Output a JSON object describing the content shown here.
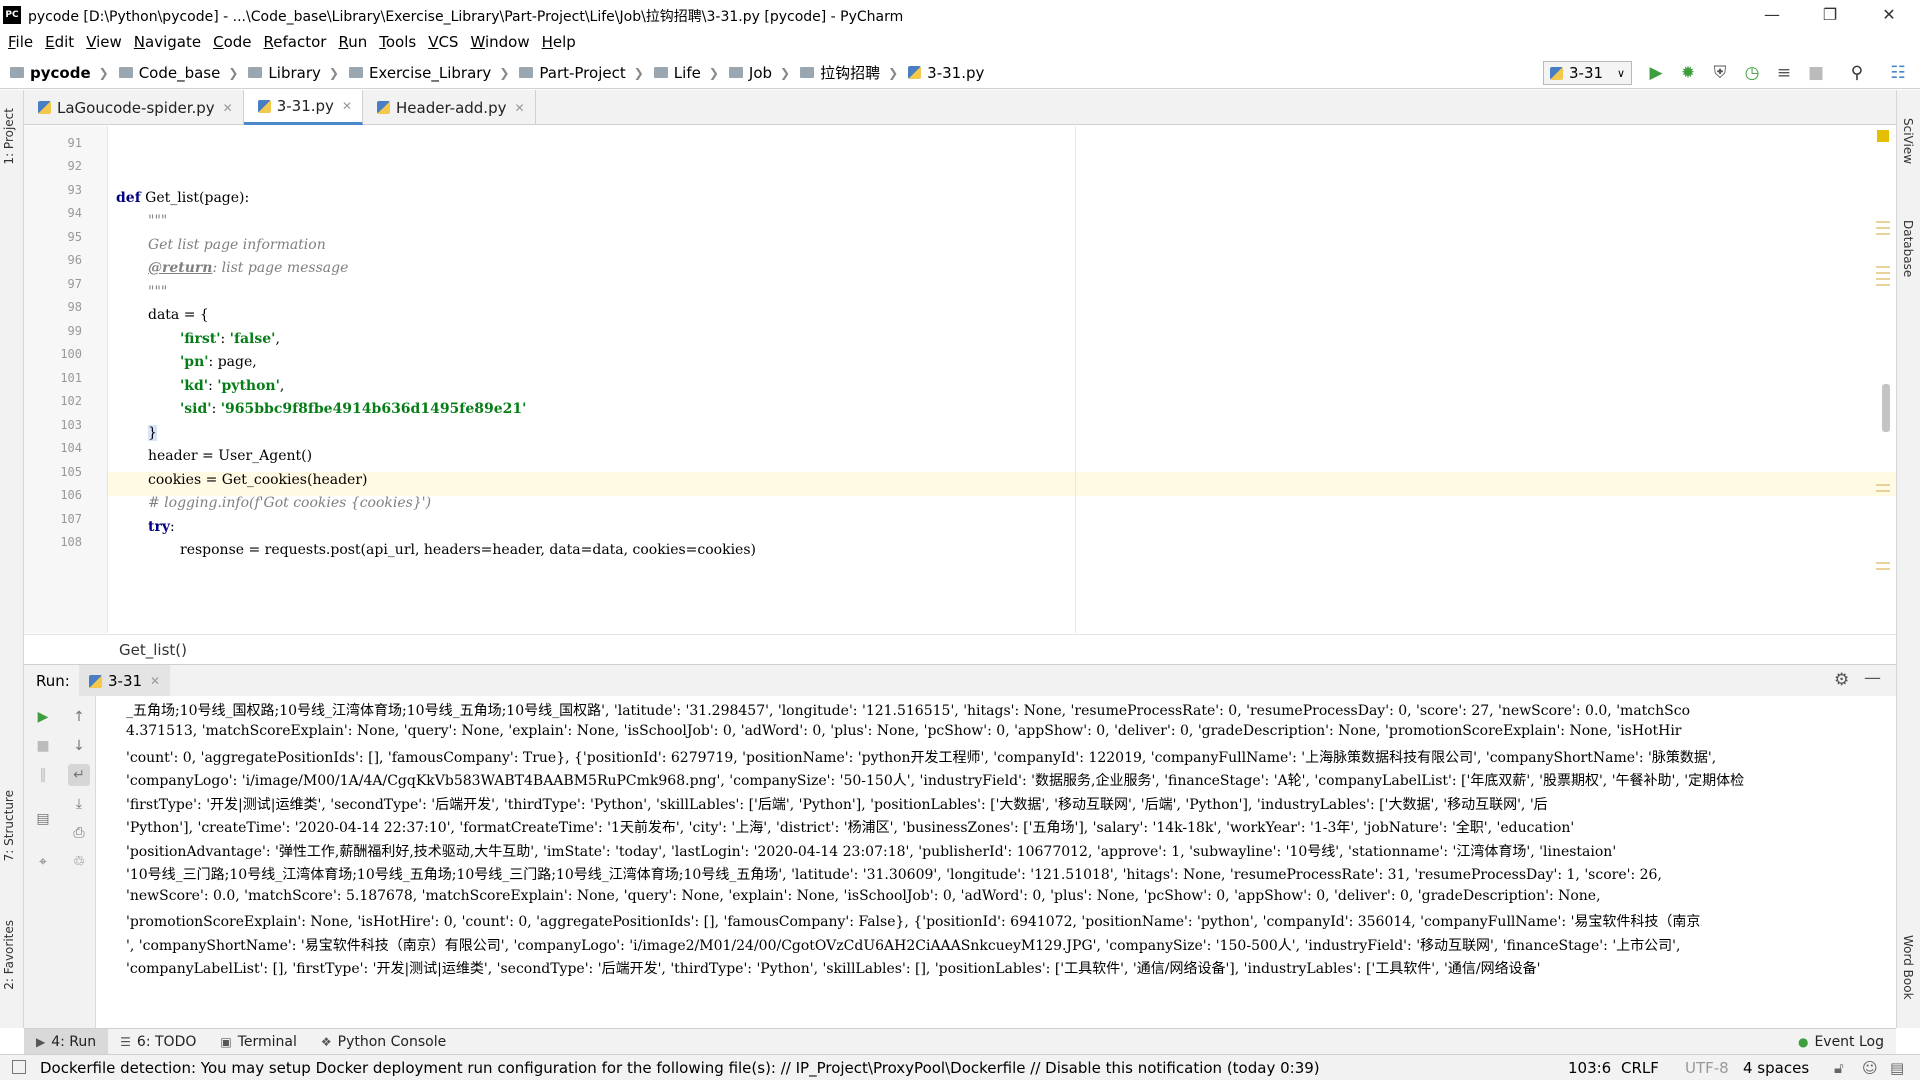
{
  "window": {
    "title": "pycode [D:\\Python\\pycode] - ...\\Code_base\\Library\\Exercise_Library\\Part-Project\\Life\\Job\\拉钩招聘\\3-31.py [pycode] - PyCharm",
    "logo": "PC"
  },
  "menu": [
    "File",
    "Edit",
    "View",
    "Navigate",
    "Code",
    "Refactor",
    "Run",
    "Tools",
    "VCS",
    "Window",
    "Help"
  ],
  "breadcrumbs": [
    "pycode",
    "Code_base",
    "Library",
    "Exercise_Library",
    "Part-Project",
    "Life",
    "Job",
    "拉钩招聘",
    "3-31.py"
  ],
  "run_config": "3-31",
  "left_tabs": {
    "project": "1: Project",
    "structure": "7: Structure",
    "favorites": "2: Favorites"
  },
  "right_tabs": {
    "sciview": "SciView",
    "database": "Database",
    "wordbook": "Word Book"
  },
  "editor_tabs": [
    {
      "label": "LaGoucode-spider.py",
      "active": false
    },
    {
      "label": "3-31.py",
      "active": true
    },
    {
      "label": "Header-add.py",
      "active": false
    }
  ],
  "line_numbers": [
    "91",
    "92",
    "93",
    "94",
    "95",
    "96",
    "97",
    "98",
    "99",
    "100",
    "101",
    "102",
    "103",
    "104",
    "105",
    "106",
    "107",
    "108"
  ],
  "code": {
    "l93_kw": "def",
    "l93_rest": " Get_list(page):",
    "l94": "\"\"\"",
    "l95": "Get list page information",
    "l96_tag": "@return",
    "l96_rest": ": list page message",
    "l97": "\"\"\"",
    "l98": "data = {",
    "l99_key": "'first'",
    "l99_rest": ": ",
    "l99_val": "'false'",
    "l99_end": ",",
    "l100_key": "'pn'",
    "l100_rest": ": page,",
    "l101_key": "'kd'",
    "l101_rest": ": ",
    "l101_val": "'python'",
    "l101_end": ",",
    "l102_key": "'sid'",
    "l102_rest": ": ",
    "l102_val": "'965bbc9f8fbe4914b636d1495fe89e21'",
    "l103": "}",
    "l104": "header = User_Agent()",
    "l105": "cookies = Get_cookies(header)",
    "l106": "# logging.info(f'Got cookies {cookies}')",
    "l107_kw": "try",
    "l107_rest": ":",
    "l108": "response = requests.post(api_url, headers=header, data=data, cookies=cookies)"
  },
  "editor_breadcrumb": "Get_list()",
  "run": {
    "label": "Run:",
    "tab": "3-31",
    "console_lines": [
      "_五角场;10号线_国权路;10号线_江湾体育场;10号线_五角场;10号线_国权路', 'latitude': '31.298457', 'longitude': '121.516515', 'hitags': None, 'resumeProcessRate': 0, 'resumeProcessDay': 0, 'score': 27, 'newScore': 0.0, 'matchSco",
      "4.371513, 'matchScoreExplain': None, 'query': None, 'explain': None, 'isSchoolJob': 0, 'adWord': 0, 'plus': None, 'pcShow': 0, 'appShow': 0, 'deliver': 0, 'gradeDescription': None, 'promotionScoreExplain': None, 'isHotHir",
      "'count': 0, 'aggregatePositionIds': [], 'famousCompany': True}, {'positionId': 6279719, 'positionName': 'python开发工程师', 'companyId': 122019, 'companyFullName': '上海脉策数据科技有限公司', 'companyShortName': '脉策数据',",
      "'companyLogo': 'i/image/M00/1A/4A/CgqKkVb583WABT4BAABM5RuPCmk968.png', 'companySize': '50-150人', 'industryField': '数据服务,企业服务', 'financeStage': 'A轮', 'companyLabelList': ['年底双薪', '股票期权', '午餐补助', '定期体检",
      "'firstType': '开发|测试|运维类', 'secondType': '后端开发', 'thirdType': 'Python', 'skillLables': ['后端', 'Python'], 'positionLables': ['大数据', '移动互联网', '后端', 'Python'], 'industryLables': ['大数据', '移动互联网', '后",
      "'Python'], 'createTime': '2020-04-14 22:37:10', 'formatCreateTime': '1天前发布', 'city': '上海', 'district': '杨浦区', 'businessZones': ['五角场'], 'salary': '14k-18k', 'workYear': '1-3年', 'jobNature': '全职', 'education'",
      "'positionAdvantage': '弹性工作,薪酬福利好,技术驱动,大牛互助', 'imState': 'today', 'lastLogin': '2020-04-14 23:07:18', 'publisherId': 10677012, 'approve': 1, 'subwayline': '10号线', 'stationname': '江湾体育场', 'linestaion'",
      "'10号线_三门路;10号线_江湾体育场;10号线_五角场;10号线_三门路;10号线_江湾体育场;10号线_五角场', 'latitude': '31.30609', 'longitude': '121.51018', 'hitags': None, 'resumeProcessRate': 31, 'resumeProcessDay': 1, 'score': 26,",
      "'newScore': 0.0, 'matchScore': 5.187678, 'matchScoreExplain': None, 'query': None, 'explain': None, 'isSchoolJob': 0, 'adWord': 0, 'plus': None, 'pcShow': 0, 'appShow': 0, 'deliver': 0, 'gradeDescription': None,",
      "'promotionScoreExplain': None, 'isHotHire': 0, 'count': 0, 'aggregatePositionIds': [], 'famousCompany': False}, {'positionId': 6941072, 'positionName': 'python', 'companyId': 356014, 'companyFullName': '易宝软件科技（南京",
      "', 'companyShortName': '易宝软件科技（南京）有限公司', 'companyLogo': 'i/image2/M01/24/00/CgotOVzCdU6AH2CiAAASnkcueyM129.JPG', 'companySize': '150-500人', 'industryField': '移动互联网', 'financeStage': '上市公司',",
      "'companyLabelList': [], 'firstType': '开发|测试|运维类', 'secondType': '后端开发', 'thirdType': 'Python', 'skillLables': [], 'positionLables': ['工具软件', '通信/网络设备'], 'industryLables': ['工具软件', '通信/网络设备'"
    ]
  },
  "bottom_tabs": [
    {
      "key": "4",
      "label": "4: Run",
      "active": true
    },
    {
      "key": "6",
      "label": "6: TODO",
      "active": false
    },
    {
      "key": "t",
      "label": "Terminal",
      "active": false
    },
    {
      "key": "p",
      "label": "Python Console",
      "active": false
    }
  ],
  "event_log": "Event Log",
  "status": {
    "message": "Dockerfile detection: You may setup Docker deployment run configuration for the following file(s): // IP_Project\\ProxyPool\\Dockerfile // Disable this notification (today 0:39)",
    "position": "103:6",
    "line_sep": "CRLF",
    "encoding": "UTF-8",
    "indent": "4 spaces"
  }
}
